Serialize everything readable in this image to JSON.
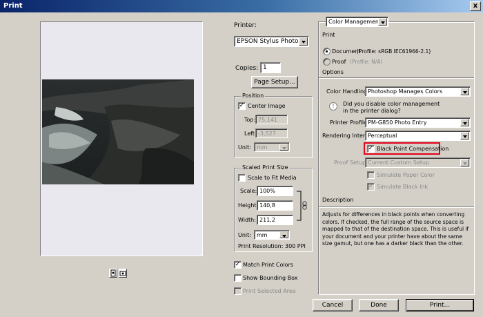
{
  "window": {
    "title": "Print",
    "close_glyph": "x"
  },
  "printer": {
    "label": "Printer:",
    "value": "EPSON Stylus Photo...",
    "copies_label": "Copies:",
    "copies_value": "1",
    "page_setup_label": "Page Setup..."
  },
  "position": {
    "group_label": "Position",
    "center_image_label": "Center Image",
    "center_image_checked": true,
    "top_label": "Top:",
    "top_value": "75,141",
    "left_label": "Left:",
    "left_value": "-3,527",
    "unit_label": "Unit:",
    "unit_value": "mm"
  },
  "scaled": {
    "group_label": "Scaled Print Size",
    "scale_to_fit_label": "Scale to Fit Media",
    "scale_label": "Scale:",
    "scale_value": "100%",
    "height_label": "Height:",
    "height_value": "140,8",
    "width_label": "Width:",
    "width_value": "211,2",
    "unit_label": "Unit:",
    "unit_value": "mm",
    "resolution": "Print Resolution: 300 PPI"
  },
  "options_left": {
    "match_colors_label": "Match Print Colors",
    "bounding_box_label": "Show Bounding Box",
    "selected_area_label": "Print Selected Area"
  },
  "right": {
    "mode_value": "Color Management",
    "print_heading": "Print",
    "document_label": "Document",
    "document_profile": "(Profile: sRGB IEC61966-2.1)",
    "proof_label": "Proof",
    "proof_profile": "(Profile: N/A)",
    "options_heading": "Options",
    "color_handling_label": "Color Handling:",
    "color_handling_value": "Photoshop Manages Colors",
    "info_text_1": "Did you disable color management",
    "info_text_2": "in the printer dialog?",
    "printer_profile_label": "Printer Profile:",
    "printer_profile_value": "PM-G850 Photo Entry",
    "rendering_intent_label": "Rendering Intent:",
    "rendering_intent_value": "Perceptual",
    "bpc_label": "Black Point Compensation",
    "proof_setup_label": "Proof Setup:",
    "proof_setup_value": "Current Custom Setup",
    "sim_paper_label": "Simulate Paper Color",
    "sim_ink_label": "Simulate Black Ink",
    "description_heading": "Description",
    "description_text": "Adjusts for differences in black points when converting colors. If checked, the full range of the source space is mapped to that of the destination space. This is useful if your document and your printer have about the same size gamut, but one has a darker black than the other."
  },
  "buttons": {
    "cancel": "Cancel",
    "done": "Done",
    "print": "Print..."
  },
  "colors": {
    "highlight": "#e3001b",
    "dialog_bg": "#d4d0c8",
    "title_bar": "#0a246a"
  },
  "icons": [
    "portrait-orientation-icon",
    "landscape-orientation-icon",
    "info-icon",
    "link-chain-icon"
  ]
}
